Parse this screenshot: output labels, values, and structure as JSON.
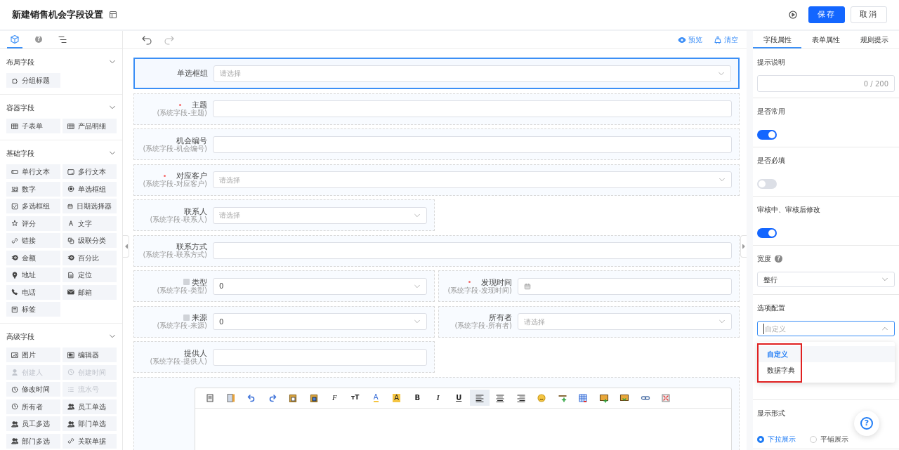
{
  "header": {
    "title": "新建销售机会字段设置",
    "buttons": [
      {
        "label": "保存",
        "kind": "primary"
      },
      {
        "label": "取消",
        "kind": "secondary"
      }
    ]
  },
  "palette": {
    "tabs": [
      {
        "selected": true
      },
      {
        "label": "?",
        "selected": false
      },
      {
        "selected": false
      }
    ],
    "groups": [
      {
        "title": "布局字段",
        "expanded": true,
        "items": [
          {
            "label": "分组标题",
            "disabled": false
          }
        ]
      },
      {
        "title": "容器字段",
        "expanded": true,
        "items": [
          {
            "label": "子表单",
            "disabled": false
          },
          {
            "label": "产品明细",
            "disabled": false
          }
        ]
      },
      {
        "title": "基础字段",
        "expanded": true,
        "items": [
          {
            "label": "单行文本",
            "disabled": false
          },
          {
            "label": "多行文本",
            "disabled": false
          },
          {
            "label": "数字",
            "disabled": false
          },
          {
            "label": "单选框组",
            "disabled": false
          },
          {
            "label": "多选框组",
            "disabled": false
          },
          {
            "label": "日期选择器",
            "disabled": false
          },
          {
            "label": "评分",
            "disabled": false
          },
          {
            "label": "文字",
            "disabled": false
          },
          {
            "label": "链接",
            "disabled": false
          },
          {
            "label": "级联分类",
            "disabled": false
          },
          {
            "label": "金额",
            "disabled": false
          },
          {
            "label": "百分比",
            "disabled": false
          },
          {
            "label": "地址",
            "disabled": false
          },
          {
            "label": "定位",
            "disabled": false
          },
          {
            "label": "电话",
            "disabled": false
          },
          {
            "label": "邮箱",
            "disabled": false
          },
          {
            "label": "标签",
            "disabled": false
          }
        ]
      },
      {
        "title": "高级字段",
        "expanded": true,
        "items": [
          {
            "label": "图片",
            "disabled": false
          },
          {
            "label": "编辑器",
            "disabled": false
          },
          {
            "label": "创建人",
            "disabled": true
          },
          {
            "label": "创建时间",
            "disabled": true
          },
          {
            "label": "修改时间",
            "disabled": false
          },
          {
            "label": "流水号",
            "disabled": true
          },
          {
            "label": "所有者",
            "disabled": false
          },
          {
            "label": "员工单选",
            "disabled": false
          },
          {
            "label": "员工多选",
            "disabled": false
          },
          {
            "label": "部门单选",
            "disabled": false
          },
          {
            "label": "部门多选",
            "disabled": false
          },
          {
            "label": "关联单据",
            "disabled": false
          }
        ]
      }
    ]
  },
  "canvas": {
    "history": [
      {
        "disabled": false
      },
      {
        "disabled": true
      }
    ],
    "actions": [
      {
        "label": "预览"
      },
      {
        "label": "清空"
      }
    ],
    "rows": [
      [
        {
          "label": "单选框组",
          "required": false,
          "locked": false,
          "kind": "select",
          "placeholder": "请选择",
          "full_width": true,
          "selected": true
        }
      ],
      [
        {
          "label": "主题",
          "note": "(系统字段-主题)",
          "required": true,
          "locked": false,
          "kind": "input",
          "full_width": true,
          "selected": false
        }
      ],
      [
        {
          "label": "机会编号",
          "note": "(系统字段-机会编号)",
          "required": false,
          "locked": false,
          "kind": "input",
          "full_width": true,
          "selected": false
        }
      ],
      [
        {
          "label": "对应客户",
          "note": "(系统字段-对应客户)",
          "required": true,
          "locked": false,
          "kind": "select",
          "placeholder": "请选择",
          "full_width": true,
          "selected": false
        }
      ],
      [
        {
          "label": "联系人",
          "note": "(系统字段-联系人)",
          "required": false,
          "locked": false,
          "kind": "select",
          "placeholder": "请选择",
          "full_width": false,
          "selected": false
        }
      ],
      [
        {
          "label": "联系方式",
          "note": "(系统字段-联系方式)",
          "required": false,
          "locked": false,
          "kind": "input",
          "full_width": true,
          "selected": false
        }
      ],
      [
        {
          "label": "类型",
          "note": "(系统字段-类型)",
          "required": false,
          "locked": true,
          "kind": "select",
          "value": "0",
          "full_width": false,
          "selected": false
        },
        {
          "label": "发现时间",
          "note": "(系统字段-发现时间)",
          "required": true,
          "locked": false,
          "kind": "date",
          "full_width": false,
          "selected": false
        }
      ],
      [
        {
          "label": "来源",
          "note": "(系统字段-来源)",
          "required": false,
          "locked": true,
          "kind": "select",
          "value": "0",
          "full_width": false,
          "selected": false
        },
        {
          "label": "所有者",
          "note": "(系统字段-所有者)",
          "required": false,
          "locked": false,
          "kind": "select",
          "placeholder": "请选择",
          "full_width": false,
          "selected": false
        }
      ],
      [
        {
          "label": "提供人",
          "note": "(系统字段-提供人)",
          "required": false,
          "locked": false,
          "kind": "input",
          "full_width": false,
          "selected": false
        }
      ]
    ],
    "editor": {
      "tools": [
        {
          "selected": false
        },
        {
          "selected": false
        },
        {
          "selected": false
        },
        {
          "selected": false
        },
        {
          "selected": false
        },
        {
          "selected": false
        },
        {
          "label": "F",
          "selected": false
        },
        {
          "label": "ᴛT",
          "selected": false
        },
        {
          "label": "A",
          "selected": false
        },
        {
          "label": "A",
          "selected": false
        },
        {
          "label": "B",
          "selected": false
        },
        {
          "label": "I",
          "selected": false
        },
        {
          "label": "U",
          "selected": false
        },
        {
          "selected": true
        },
        {
          "selected": false
        },
        {
          "selected": false
        },
        {
          "selected": false
        },
        {
          "selected": false
        },
        {
          "selected": false
        },
        {
          "selected": false
        },
        {
          "selected": false
        },
        {
          "selected": false
        },
        {
          "selected": false
        }
      ]
    }
  },
  "properties": {
    "tabs": [
      {
        "label": "字段属性",
        "selected": true
      },
      {
        "label": "表单属性",
        "selected": false
      },
      {
        "label": "规则提示",
        "selected": false
      }
    ],
    "sections": [
      {
        "kind": "textarea",
        "title": "提示说明",
        "counter": "0 / 200"
      },
      {
        "kind": "switch",
        "title": "是否常用",
        "on": true
      },
      {
        "kind": "switch",
        "title": "是否必填",
        "on": false
      },
      {
        "kind": "switch",
        "title": "审核中、审核后修改",
        "on": true
      },
      {
        "kind": "select",
        "title": "宽度",
        "help": "?",
        "value": "整行"
      },
      {
        "kind": "dropdown",
        "title": "选项配置",
        "placeholder": "自定义",
        "expanded": true,
        "highlighted": true,
        "options": [
          {
            "label": "自定义",
            "selected": true
          },
          {
            "label": "数据字典",
            "selected": false
          }
        ]
      },
      {
        "kind": "radio",
        "title": "显示形式",
        "options": [
          {
            "label": "下拉展示",
            "selected": true
          },
          {
            "label": "平铺展示",
            "selected": false
          }
        ]
      }
    ]
  },
  "help_button": {
    "label": "?"
  }
}
